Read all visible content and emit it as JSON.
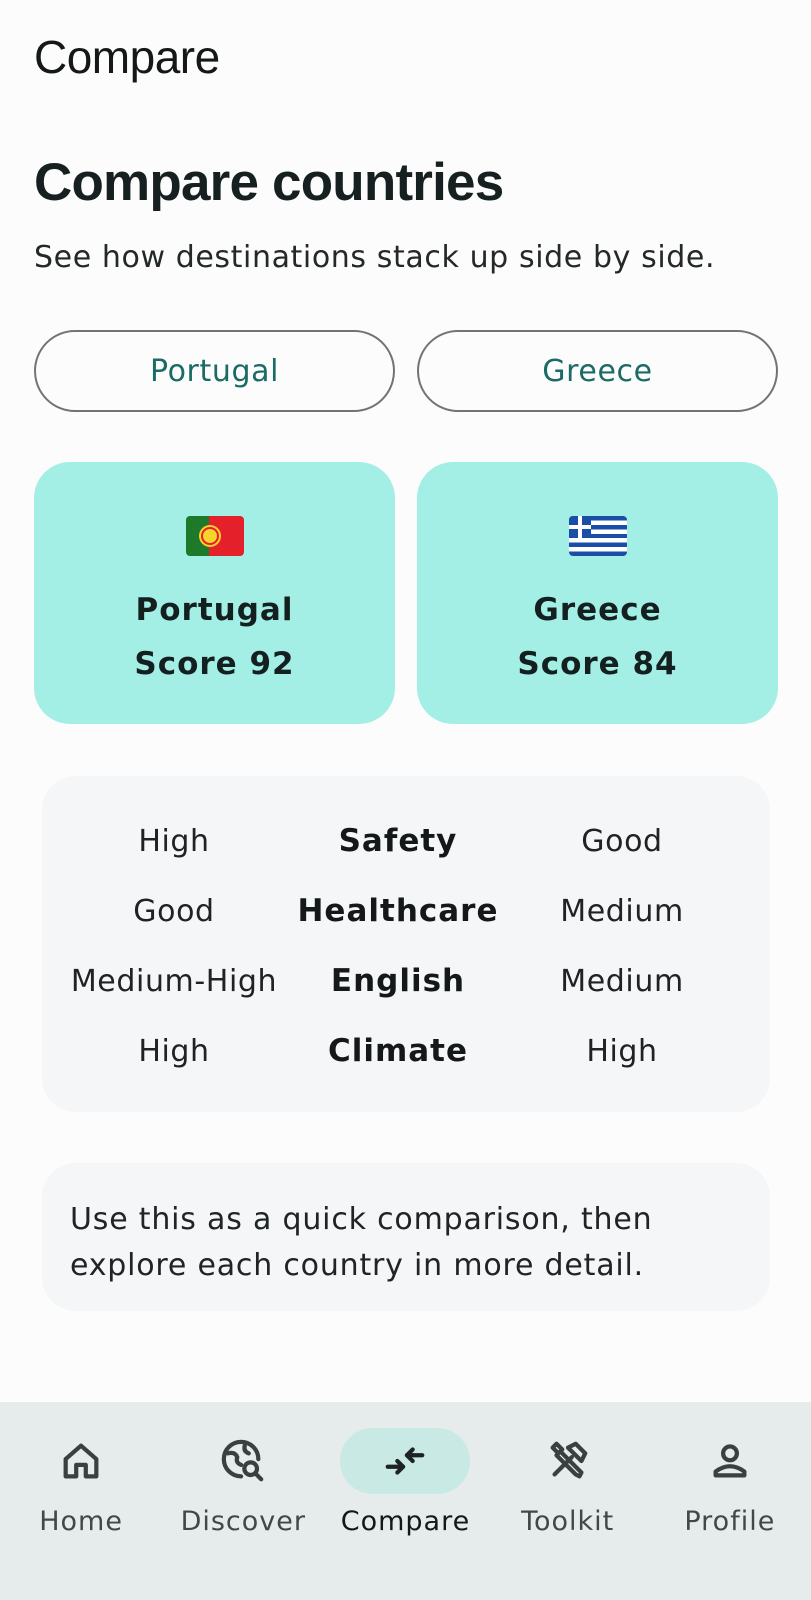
{
  "app_bar": {
    "title": "Compare"
  },
  "header": {
    "title": "Compare countries",
    "subtitle": "See how destinations stack up side by side."
  },
  "selectors": [
    {
      "label": "Portugal"
    },
    {
      "label": "Greece"
    }
  ],
  "cards": [
    {
      "flag_icon": "portugal-flag-icon",
      "name": "Portugal",
      "score": "Score 92"
    },
    {
      "flag_icon": "greece-flag-icon",
      "name": "Greece",
      "score": "Score 84"
    }
  ],
  "metrics": [
    {
      "left": "High",
      "label": "Safety",
      "right": "Good"
    },
    {
      "left": "Good",
      "label": "Healthcare",
      "right": "Medium"
    },
    {
      "left": "Medium-High",
      "label": "English",
      "right": "Medium"
    },
    {
      "left": "High",
      "label": "Climate",
      "right": "High"
    }
  ],
  "note": "Use this as a quick comparison, then explore each country in more detail.",
  "nav": {
    "items": [
      {
        "label": "Home",
        "icon": "home-icon"
      },
      {
        "label": "Discover",
        "icon": "travel-explore-icon"
      },
      {
        "label": "Compare",
        "icon": "compare-arrows-icon",
        "active": true
      },
      {
        "label": "Toolkit",
        "icon": "tools-icon"
      },
      {
        "label": "Profile",
        "icon": "person-icon"
      }
    ]
  },
  "colors": {
    "accent_text": "#1a6b63",
    "card_bg": "#a3efe6",
    "nav_bg": "#e6ebeb",
    "nav_active_pill": "#c9e9e4"
  }
}
